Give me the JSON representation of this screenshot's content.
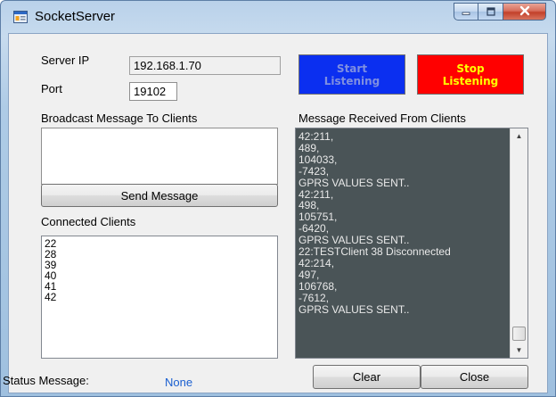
{
  "window": {
    "title": "SocketServer",
    "icon": "application-icon",
    "caption_buttons": {
      "minimize": "minimize-icon",
      "maximize": "maximize-icon",
      "close": "close-icon"
    }
  },
  "server": {
    "ip_label": "Server IP",
    "ip_value": "192.168.1.70",
    "port_label": "Port",
    "port_value": "19102"
  },
  "buttons": {
    "start_line1": "Start",
    "start_line2": "Listening",
    "stop_line1": "Stop",
    "stop_line2": "Listening",
    "send": "Send Message",
    "clear": "Clear",
    "close": "Close"
  },
  "broadcast": {
    "label": "Broadcast Message To Clients",
    "value": ""
  },
  "connected_clients": {
    "label": "Connected Clients",
    "items": [
      "22",
      "28",
      "39",
      "40",
      "41",
      "42"
    ]
  },
  "messages": {
    "label": "Message Received From Clients",
    "lines": [
      "42:211,",
      "489,",
      "104033,",
      "-7423,",
      "GPRS VALUES SENT..",
      "42:211,",
      "498,",
      "105751,",
      "-6420,",
      "GPRS VALUES SENT..",
      "22:TESTClient 38 Disconnected",
      "42:214,",
      "497,",
      "106768,",
      "-7612,",
      "GPRS VALUES SENT.."
    ]
  },
  "status": {
    "label": "Status Message:",
    "value": "None"
  },
  "colors": {
    "start_bg": "#0b2ff0",
    "stop_bg": "#ff0000",
    "stop_text": "#ffff00",
    "message_bg": "#4a5457",
    "status_value": "#1a5fd0"
  }
}
